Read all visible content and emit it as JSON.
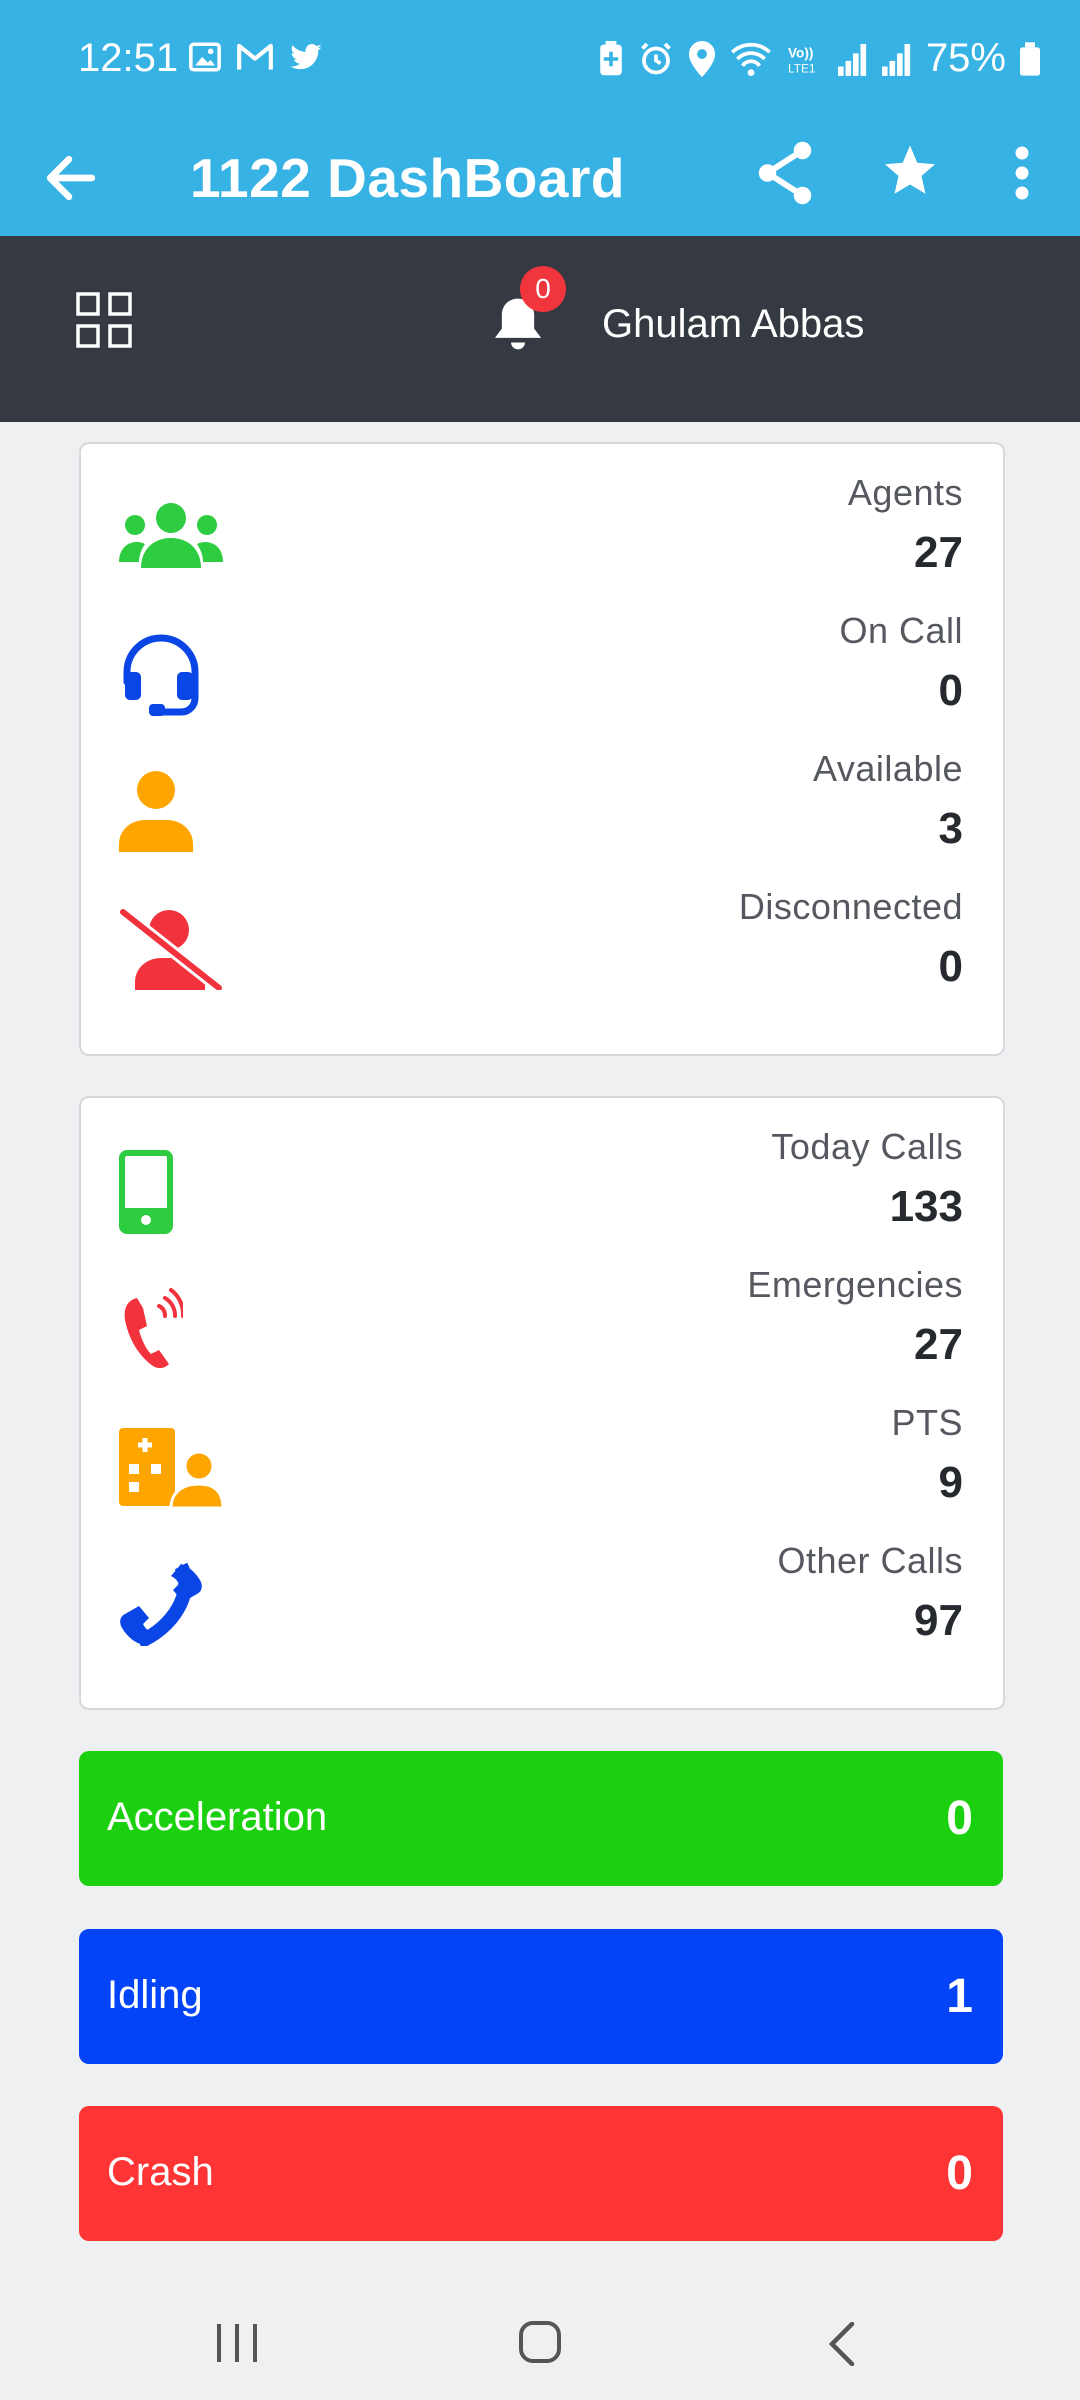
{
  "status_bar": {
    "time": "12:51",
    "battery_text": "75%",
    "left_icons": [
      "image-icon",
      "gmail-icon",
      "twitter-icon"
    ],
    "right_icons": [
      "battery-saver-icon",
      "alarm-icon",
      "location-icon",
      "wifi-icon",
      "volte-icon",
      "signal-icon",
      "signal-icon",
      "battery-icon"
    ]
  },
  "app_bar": {
    "title": "1122 DashBoard",
    "icons": [
      "back-arrow-icon",
      "share-icon",
      "star-icon",
      "more-vert-icon"
    ]
  },
  "header": {
    "notification_count": "0",
    "user_name": "Ghulam Abbas"
  },
  "agents_card": [
    {
      "label": "Agents",
      "value": "27",
      "icon": "group-icon",
      "color": "#2ecc40"
    },
    {
      "label": "On Call",
      "value": "0",
      "icon": "headset-icon",
      "color": "#0a45e6"
    },
    {
      "label": "Available",
      "value": "3",
      "icon": "person-icon",
      "color": "#ffa500"
    },
    {
      "label": "Disconnected",
      "value": "0",
      "icon": "person-off-icon",
      "color": "#f2333d"
    }
  ],
  "calls_card": [
    {
      "label": "Today Calls",
      "value": "133",
      "icon": "mobile-phone-icon",
      "color": "#2ecc40"
    },
    {
      "label": "Emergencies",
      "value": "27",
      "icon": "phone-ringing-icon",
      "color": "#f2333d"
    },
    {
      "label": "PTS",
      "value": "9",
      "icon": "hospital-user-icon",
      "color": "#ffa500"
    },
    {
      "label": "Other Calls",
      "value": "97",
      "icon": "phone-icon",
      "color": "#0a45e6"
    }
  ],
  "stat_bars": [
    {
      "label": "Acceleration",
      "value": "0",
      "color": "#1bd00f"
    },
    {
      "label": "Idling",
      "value": "1",
      "color": "#0344f8"
    },
    {
      "label": "Crash",
      "value": "0",
      "color": "#fe3435"
    }
  ]
}
